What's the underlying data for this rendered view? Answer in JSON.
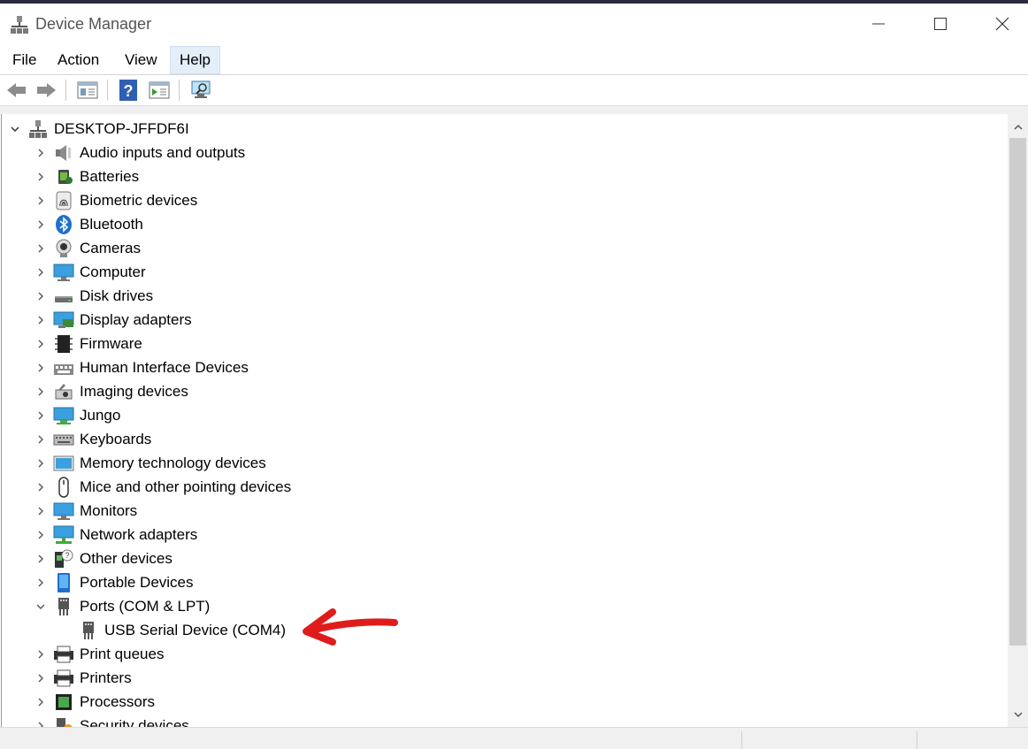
{
  "window": {
    "title": "Device Manager"
  },
  "menu": [
    "File",
    "Action",
    "View",
    "Help"
  ],
  "menu_active": "Help",
  "toolbar": [
    "back-icon",
    "forward-icon",
    "properties-icon",
    "help-icon",
    "update-driver-icon",
    "scan-hardware-icon"
  ],
  "tree": {
    "root": "DESKTOP-JFFDF6I",
    "items": [
      {
        "label": "Audio inputs and outputs",
        "icon": "speaker-icon"
      },
      {
        "label": "Batteries",
        "icon": "battery-icon"
      },
      {
        "label": "Biometric devices",
        "icon": "fingerprint-icon"
      },
      {
        "label": "Bluetooth",
        "icon": "bluetooth-icon"
      },
      {
        "label": "Cameras",
        "icon": "camera-icon"
      },
      {
        "label": "Computer",
        "icon": "computer-icon"
      },
      {
        "label": "Disk drives",
        "icon": "disk-icon"
      },
      {
        "label": "Display adapters",
        "icon": "display-adapter-icon"
      },
      {
        "label": "Firmware",
        "icon": "firmware-icon"
      },
      {
        "label": "Human Interface Devices",
        "icon": "hid-icon"
      },
      {
        "label": "Imaging devices",
        "icon": "imaging-icon"
      },
      {
        "label": "Jungo",
        "icon": "jungo-icon"
      },
      {
        "label": "Keyboards",
        "icon": "keyboard-icon"
      },
      {
        "label": "Memory technology devices",
        "icon": "memory-icon"
      },
      {
        "label": "Mice and other pointing devices",
        "icon": "mouse-icon"
      },
      {
        "label": "Monitors",
        "icon": "monitor-icon"
      },
      {
        "label": "Network adapters",
        "icon": "network-icon"
      },
      {
        "label": "Other devices",
        "icon": "unknown-device-icon"
      },
      {
        "label": "Portable Devices",
        "icon": "portable-device-icon"
      },
      {
        "label": "Ports (COM & LPT)",
        "icon": "port-icon",
        "expanded": true,
        "children": [
          {
            "label": "USB Serial Device (COM4)",
            "icon": "port-icon"
          }
        ]
      },
      {
        "label": "Print queues",
        "icon": "printer-icon"
      },
      {
        "label": "Printers",
        "icon": "printer-icon"
      },
      {
        "label": "Processors",
        "icon": "processor-icon"
      },
      {
        "label": "Security devices",
        "icon": "security-icon"
      }
    ]
  },
  "colors": {
    "annotation_arrow": "#e01b1b",
    "menu_active_bg": "#e4eef8",
    "scroll_thumb": "#cdcdcd"
  }
}
